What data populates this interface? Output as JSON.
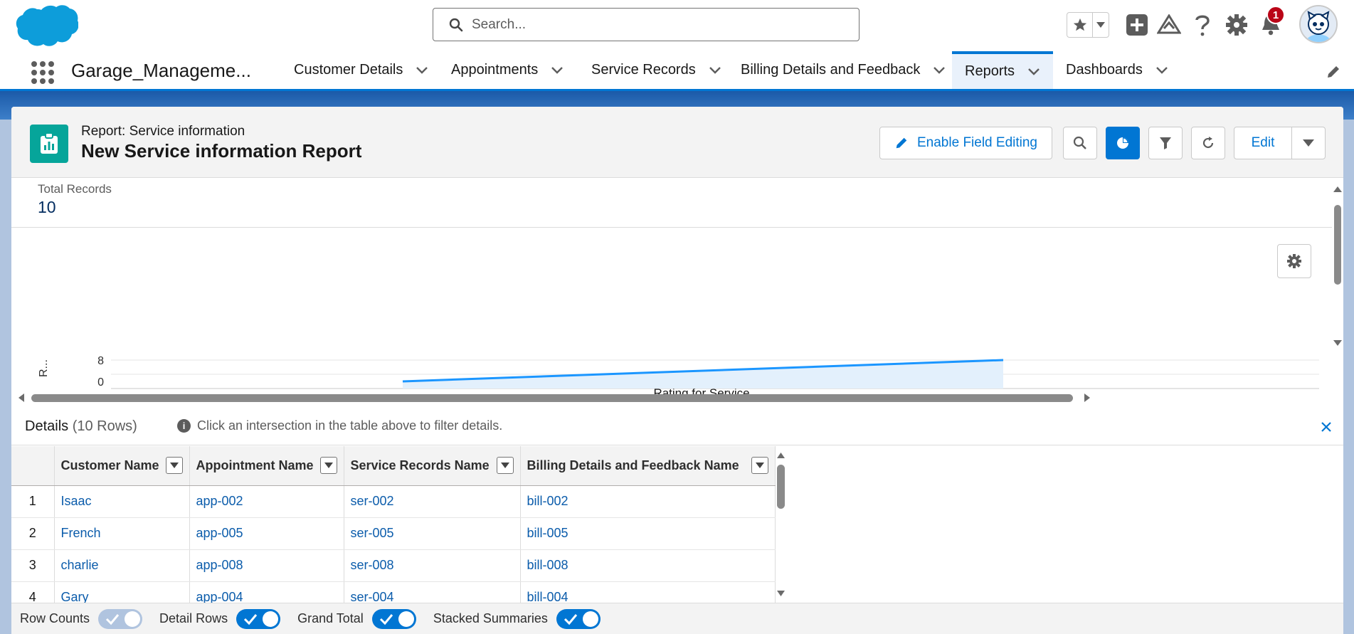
{
  "header": {
    "search_placeholder": "Search...",
    "notification_count": "1"
  },
  "nav": {
    "app_name": "Garage_Manageme...",
    "items": [
      {
        "label": "Customer Details"
      },
      {
        "label": "Appointments"
      },
      {
        "label": "Service Records"
      },
      {
        "label": "Billing Details and Feedback"
      },
      {
        "label": "Reports"
      },
      {
        "label": "Dashboards"
      }
    ],
    "active": "Reports"
  },
  "report": {
    "subtitle": "Report: Service information",
    "title": "New Service information Report",
    "enable_field_editing": "Enable Field Editing",
    "edit": "Edit",
    "total_records_label": "Total Records",
    "total_records_value": "10"
  },
  "chart_data": {
    "type": "area",
    "xlabel": "Rating for Service",
    "ylabel": "R...",
    "yticks": [
      "8",
      "0"
    ],
    "ylim": [
      0,
      8
    ],
    "series": [
      {
        "values": [
          0,
          8
        ]
      }
    ],
    "grid": true
  },
  "details": {
    "title": "Details",
    "rows_label": "(10 Rows)",
    "info": "Click an intersection in the table above to filter details.",
    "columns": [
      "Customer Name",
      "Appointment Name",
      "Service Records Name",
      "Billing Details and Feedback Name"
    ],
    "rows": [
      {
        "n": "1",
        "customer": "Isaac",
        "appointment": "app-002",
        "service": "ser-002",
        "billing": "bill-002"
      },
      {
        "n": "2",
        "customer": "French",
        "appointment": "app-005",
        "service": "ser-005",
        "billing": "bill-005"
      },
      {
        "n": "3",
        "customer": "charlie",
        "appointment": "app-008",
        "service": "ser-008",
        "billing": "bill-008"
      },
      {
        "n": "4",
        "customer": "Gary",
        "appointment": "app-004",
        "service": "ser-004",
        "billing": "bill-004"
      }
    ]
  },
  "footer": {
    "row_counts": "Row Counts",
    "detail_rows": "Detail Rows",
    "grand_total": "Grand Total",
    "stacked_summaries": "Stacked Summaries"
  },
  "colors": {
    "brand": "#0176d3",
    "report_icon": "#06a59a",
    "link": "#0b5cab",
    "badge": "#ba0517"
  }
}
